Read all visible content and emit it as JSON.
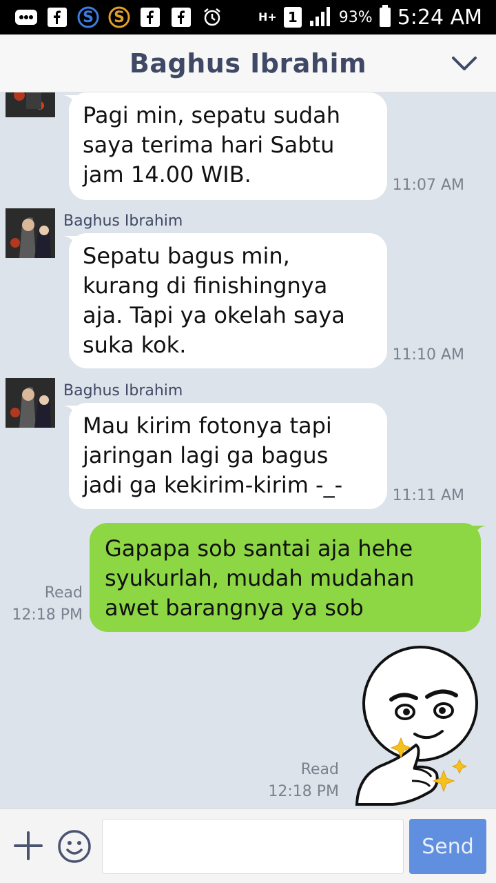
{
  "status_bar": {
    "network": "H+",
    "sim_slot": "1",
    "battery_percent": "93%",
    "time": "5:24 AM",
    "icons": [
      "more-icon",
      "facebook-icon",
      "s-app-blue-icon",
      "s-app-orange-icon",
      "facebook-icon",
      "facebook-icon",
      "alarm-icon",
      "signal-icon",
      "battery-icon"
    ]
  },
  "header": {
    "title": "Baghus Ibrahim",
    "chevron": "chevron-down-icon"
  },
  "messages": [
    {
      "direction": "in",
      "sender": "",
      "text": "Pagi min, sepatu sudah saya terima hari Sabtu jam 14.00 WIB.",
      "time": "11:07 AM"
    },
    {
      "direction": "in",
      "sender": "Baghus Ibrahim",
      "text": "Sepatu bagus min, kurang di finishingnya aja. Tapi ya okelah saya suka kok.",
      "time": "11:10 AM"
    },
    {
      "direction": "in",
      "sender": "Baghus Ibrahim",
      "text": "Mau kirim fotonya tapi jaringan lagi ga bagus jadi ga kekirim-kirim -_-",
      "time": "11:11 AM"
    },
    {
      "direction": "out",
      "text": "Gapapa sob santai aja hehe syukurlah, mudah mudahan awet barangnya ya sob",
      "read": "Read",
      "time": "12:18 PM"
    },
    {
      "direction": "out",
      "type": "sticker",
      "sticker": "thumbs-up-smirk-sticker",
      "read": "Read",
      "time": "12:18 PM"
    }
  ],
  "input_bar": {
    "plus_icon": "plus-icon",
    "emoji_icon": "emoji-icon",
    "placeholder": "",
    "value": "",
    "send_label": "Send"
  },
  "colors": {
    "chat_background": "#dde3ea",
    "outgoing_bubble": "#8dd644",
    "incoming_bubble": "#ffffff",
    "header_title": "#3f4864",
    "send_button": "#5f8fde"
  }
}
